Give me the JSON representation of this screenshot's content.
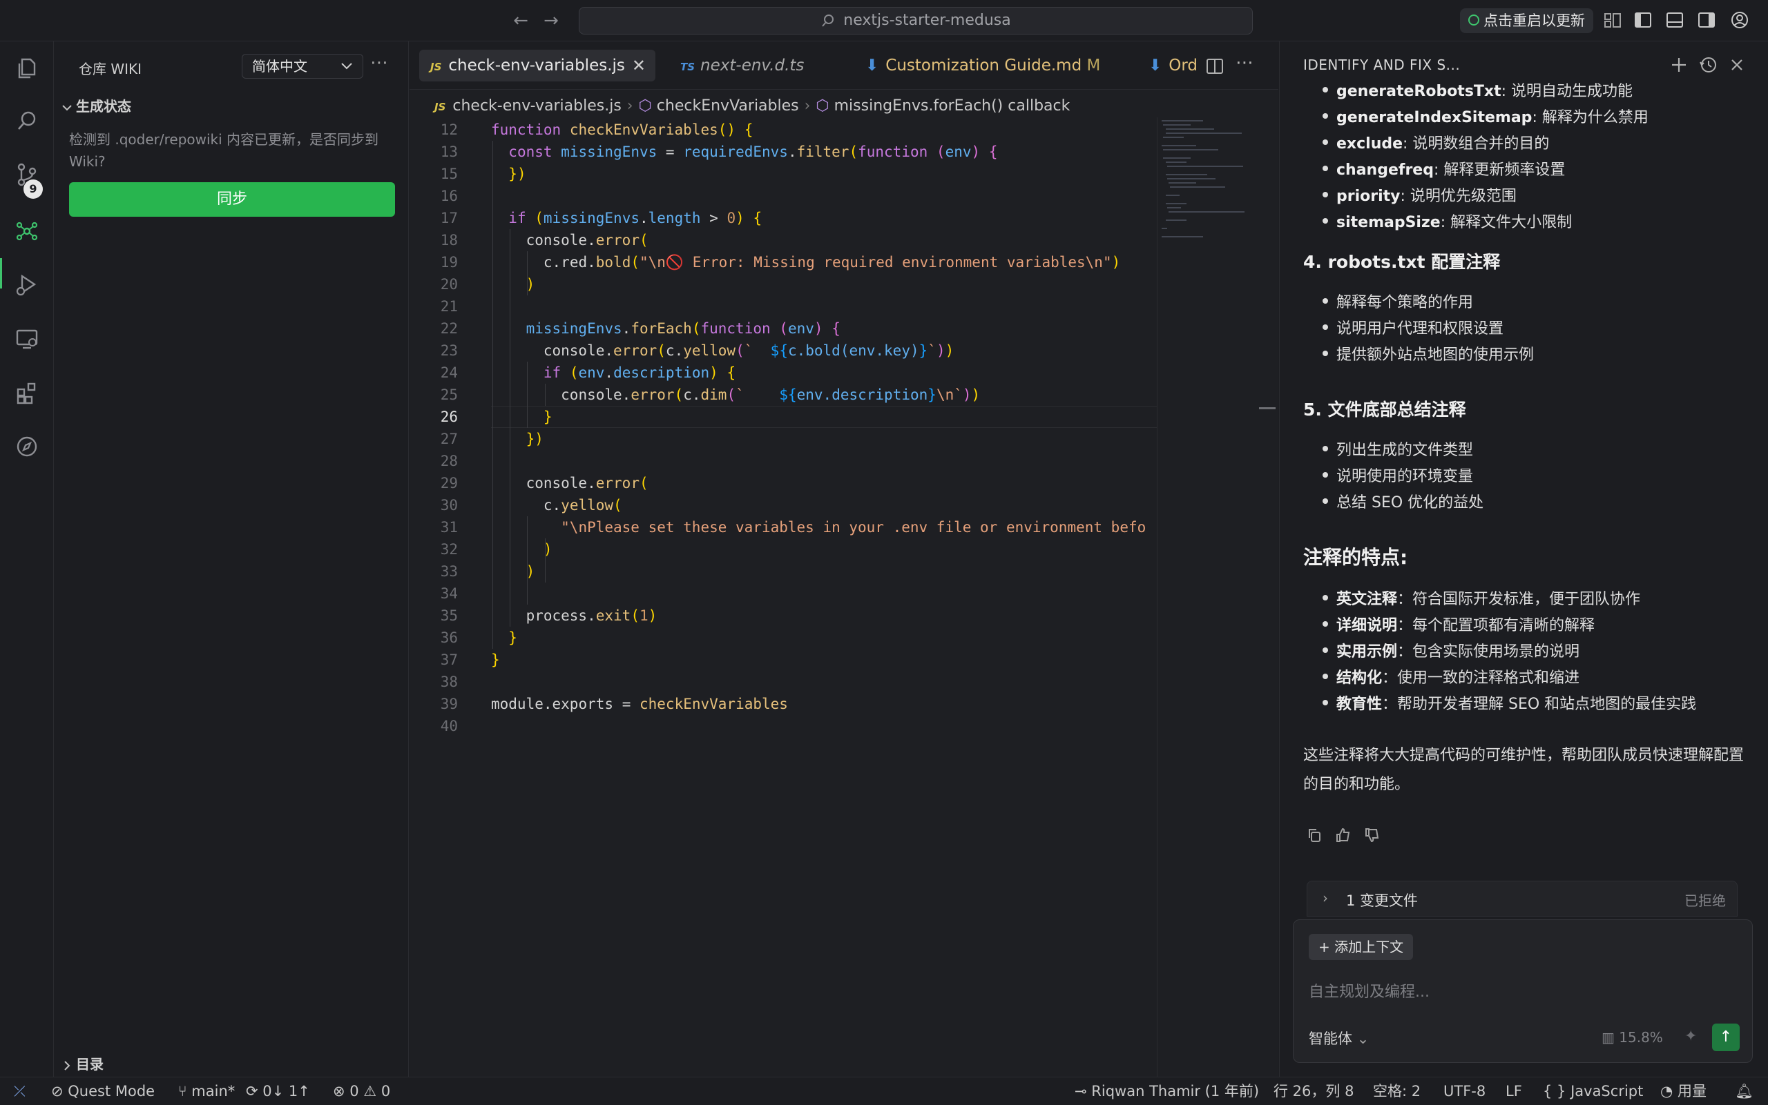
{
  "titlebar": {
    "search_text": "nextjs-starter-medusa",
    "update_label": "点击重启以更新"
  },
  "activity": {
    "scm_badge": "9"
  },
  "sidebar": {
    "title": "仓库 WIKI",
    "language": "简体中文",
    "section_label": "生成状态",
    "sync_message": "检测到 .qoder/repowiki 内容已更新，是否同步到 Wiki?",
    "sync_button": "同步",
    "toc_label": "目录"
  },
  "tabs": [
    {
      "label": "check-env-variables.js",
      "type": "JS",
      "active": true
    },
    {
      "label": "next-env.d.ts",
      "type": "TS",
      "active": false
    },
    {
      "label": "Customization Guide.md",
      "suffix": "M",
      "active": false
    },
    {
      "label": "Ord",
      "active": false
    }
  ],
  "breadcrumb": [
    "check-env-variables.js",
    "checkEnvVariables",
    "missingEnvs.forEach() callback"
  ],
  "breadcrumb_js": "JS",
  "code_lines": [
    {
      "n": "12",
      "text": "function checkEnvVariables() {"
    },
    {
      "n": "13",
      "text": "  const missingEnvs = requiredEnvs.filter(function (env) {"
    },
    {
      "n": "15",
      "text": "  })"
    },
    {
      "n": "16",
      "text": ""
    },
    {
      "n": "17",
      "text": "  if (missingEnvs.length > 0) {"
    },
    {
      "n": "18",
      "text": "    console.error("
    },
    {
      "n": "19",
      "text": "      c.red.bold(\"\\n🚫 Error: Missing required environment variables\\n\")"
    },
    {
      "n": "20",
      "text": "    )"
    },
    {
      "n": "21",
      "text": ""
    },
    {
      "n": "22",
      "text": "    missingEnvs.forEach(function (env) {"
    },
    {
      "n": "23",
      "text": "      console.error(c.yellow(`  ${c.bold(env.key)}`))"
    },
    {
      "n": "24",
      "text": "      if (env.description) {"
    },
    {
      "n": "25",
      "text": "        console.error(c.dim(`    ${env.description}\\n`))"
    },
    {
      "n": "26",
      "text": "      }"
    },
    {
      "n": "27",
      "text": "    })"
    },
    {
      "n": "28",
      "text": ""
    },
    {
      "n": "29",
      "text": "    console.error("
    },
    {
      "n": "30",
      "text": "      c.yellow("
    },
    {
      "n": "31",
      "text": "        \"\\nPlease set these variables in your .env file or environment befo"
    },
    {
      "n": "32",
      "text": "      )"
    },
    {
      "n": "33",
      "text": "    )"
    },
    {
      "n": "34",
      "text": ""
    },
    {
      "n": "35",
      "text": "    process.exit(1)"
    },
    {
      "n": "36",
      "text": "  }"
    },
    {
      "n": "37",
      "text": "}"
    },
    {
      "n": "38",
      "text": ""
    },
    {
      "n": "39",
      "text": "module.exports = checkEnvVariables"
    },
    {
      "n": "40",
      "text": ""
    }
  ],
  "current_line": "26",
  "chat": {
    "title": "IDENTIFY AND FIX S...",
    "top_bullets": [
      {
        "key": "generateRobotsTxt",
        "desc": ": 说明自动生成功能"
      },
      {
        "key": "generateIndexSitemap",
        "desc": ": 解释为什么禁用"
      },
      {
        "key": "exclude",
        "desc": ": 说明数组合并的目的"
      },
      {
        "key": "changefreq",
        "desc": ": 解释更新频率设置"
      },
      {
        "key": "priority",
        "desc": ": 说明优先级范围"
      },
      {
        "key": "sitemapSize",
        "desc": ": 解释文件大小限制"
      }
    ],
    "h4": "4. robots.txt 配置注释",
    "robots_bullets": [
      "解释每个策略的作用",
      "说明用户代理和权限设置",
      "提供额外站点地图的使用示例"
    ],
    "h5": "5. 文件底部总结注释",
    "summary_bullets": [
      "列出生成的文件类型",
      "说明使用的环境变量",
      "总结 SEO 优化的益处"
    ],
    "features_title": "注释的特点:",
    "features": [
      {
        "key": "英文注释",
        "desc": "：符合国际开发标准，便于团队协作"
      },
      {
        "key": "详细说明",
        "desc": "：每个配置项都有清晰的解释"
      },
      {
        "key": "实用示例",
        "desc": "：包含实际使用场景的说明"
      },
      {
        "key": "结构化",
        "desc": "：使用一致的注释格式和缩进"
      },
      {
        "key": "教育性",
        "desc": "：帮助开发者理解 SEO 和站点地图的最佳实践"
      }
    ],
    "conclusion": "这些注释将大大提高代码的可维护性，帮助团队成员快速理解配置的目的和功能。",
    "changed_files": "1 变更文件",
    "rejected": "已拒绝",
    "add_context": "添加上下文",
    "input_placeholder": "自主规划及编程...",
    "agent_mode": "智能体",
    "usage_pct": "15.8%"
  },
  "status": {
    "mode": "Quest Mode",
    "branch": "main*",
    "sync": "0↓ 1↑",
    "errors": "0",
    "warnings": "0",
    "blame": "Riqwan Thamir (1 年前)",
    "position": "行 26，列 8",
    "spaces": "空格: 2",
    "encoding": "UTF-8",
    "eol": "LF",
    "language": "JavaScript",
    "usage": "用量"
  },
  "colors": {
    "accent": "#28b54f",
    "keyword": "#c678dd",
    "function": "#e6c07b",
    "variable": "#61afef",
    "string": "#e5a07a"
  }
}
